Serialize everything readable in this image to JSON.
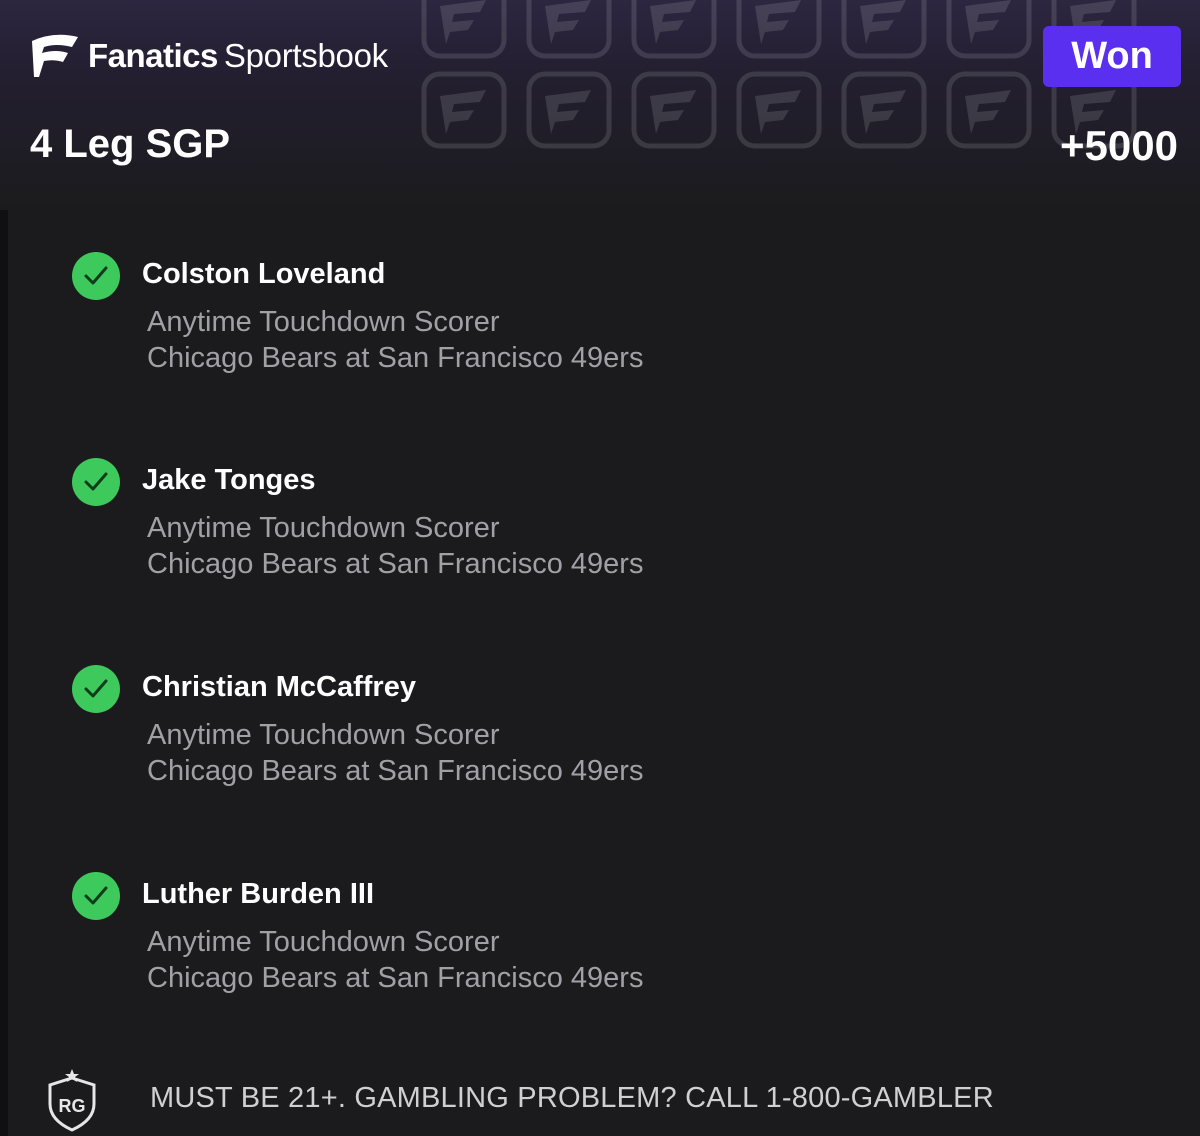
{
  "brand": {
    "name_bold": "Fanatics",
    "name_light": "Sportsbook",
    "logo_icon": "fanatics-flag-icon"
  },
  "bet": {
    "status": "Won",
    "title": "4 Leg SGP",
    "odds": "+5000",
    "status_color": "#5b2ff0",
    "win_color": "#3ec95c"
  },
  "legs": [
    {
      "player": "Colston Loveland",
      "market": "Anytime Touchdown Scorer",
      "event": "Chicago Bears at San Francisco 49ers",
      "icon": "check-circle-icon"
    },
    {
      "player": "Jake Tonges",
      "market": "Anytime Touchdown Scorer",
      "event": "Chicago Bears at San Francisco 49ers",
      "icon": "check-circle-icon"
    },
    {
      "player": "Christian McCaffrey",
      "market": "Anytime Touchdown Scorer",
      "event": "Chicago Bears at San Francisco 49ers",
      "icon": "check-circle-icon"
    },
    {
      "player": "Luther Burden III",
      "market": "Anytime Touchdown Scorer",
      "event": "Chicago Bears at San Francisco 49ers",
      "icon": "check-circle-icon"
    }
  ],
  "footer": {
    "rg_badge": "RG",
    "disclaimer": "MUST BE 21+. GAMBLING PROBLEM? CALL 1-800-GAMBLER"
  }
}
